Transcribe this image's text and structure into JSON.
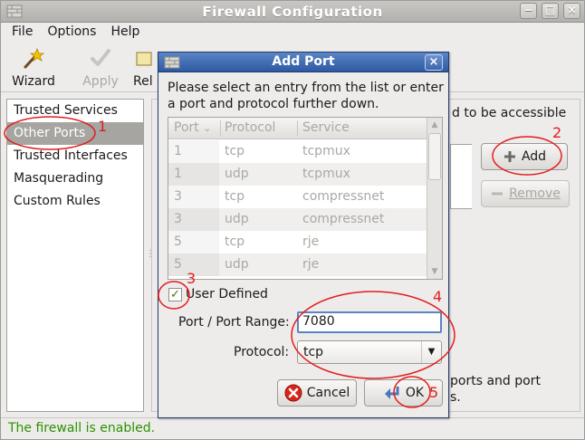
{
  "window": {
    "title": "Firewall Configuration",
    "controls": {
      "minimize": "−",
      "maximize": "□",
      "close": "×"
    }
  },
  "menubar": {
    "items": [
      {
        "label": "File",
        "mnemonic": "F"
      },
      {
        "label": "Options",
        "mnemonic": "O"
      },
      {
        "label": "Help",
        "mnemonic": "H"
      }
    ]
  },
  "toolbar": {
    "wizard": {
      "label": "Wizard",
      "icon": "wand-icon"
    },
    "apply": {
      "label": "Apply",
      "icon": "checkmark-icon",
      "disabled": true
    },
    "reload": {
      "label": "Rel",
      "icon": "reload-icon"
    }
  },
  "sidebar": {
    "items": [
      {
        "label": "Trusted Services"
      },
      {
        "label": "Other Ports",
        "selected": true
      },
      {
        "label": "Trusted Interfaces"
      },
      {
        "label": "Masquerading"
      },
      {
        "label": "Custom Rules"
      }
    ]
  },
  "main": {
    "description_tail": "d to be accessible",
    "add_button": {
      "label": "Add",
      "mnemonic": "A",
      "icon": "plus-icon"
    },
    "remove_button": {
      "label": "Remove",
      "mnemonic": "R",
      "icon": "minus-icon",
      "disabled": true
    },
    "footer_line1": "ports and port",
    "footer_line2": "s."
  },
  "status": {
    "text": "The firewall is enabled.",
    "color": "#2d9100"
  },
  "dialog": {
    "title": "Add Port",
    "close": "×",
    "intro": "Please select an entry from the list or enter a port and protocol further down.",
    "table": {
      "headers": [
        "Port",
        "Protocol",
        "Service"
      ],
      "sort_indicator": "⌄",
      "rows": [
        {
          "port": "1",
          "protocol": "tcp",
          "service": "tcpmux"
        },
        {
          "port": "1",
          "protocol": "udp",
          "service": "tcpmux"
        },
        {
          "port": "3",
          "protocol": "tcp",
          "service": "compressnet"
        },
        {
          "port": "3",
          "protocol": "udp",
          "service": "compressnet"
        },
        {
          "port": "5",
          "protocol": "tcp",
          "service": "rje"
        },
        {
          "port": "5",
          "protocol": "udp",
          "service": "rje"
        }
      ]
    },
    "user_defined": {
      "label": "User Defined",
      "mnemonic": "U",
      "checked": true,
      "check": "✓"
    },
    "port_label": "Port / Port Range:",
    "port_value": "7080",
    "protocol_label": "Protocol:",
    "protocol_value": "tcp",
    "cancel": {
      "label": "Cancel",
      "mnemonic": "C",
      "icon": "cancel-icon"
    },
    "ok": {
      "label": "OK",
      "mnemonic": "O",
      "icon": "ok-arrow-icon"
    }
  },
  "annotations": {
    "color": "#e21d1d",
    "numbers": [
      "1",
      "2",
      "3",
      "4",
      "5"
    ]
  }
}
